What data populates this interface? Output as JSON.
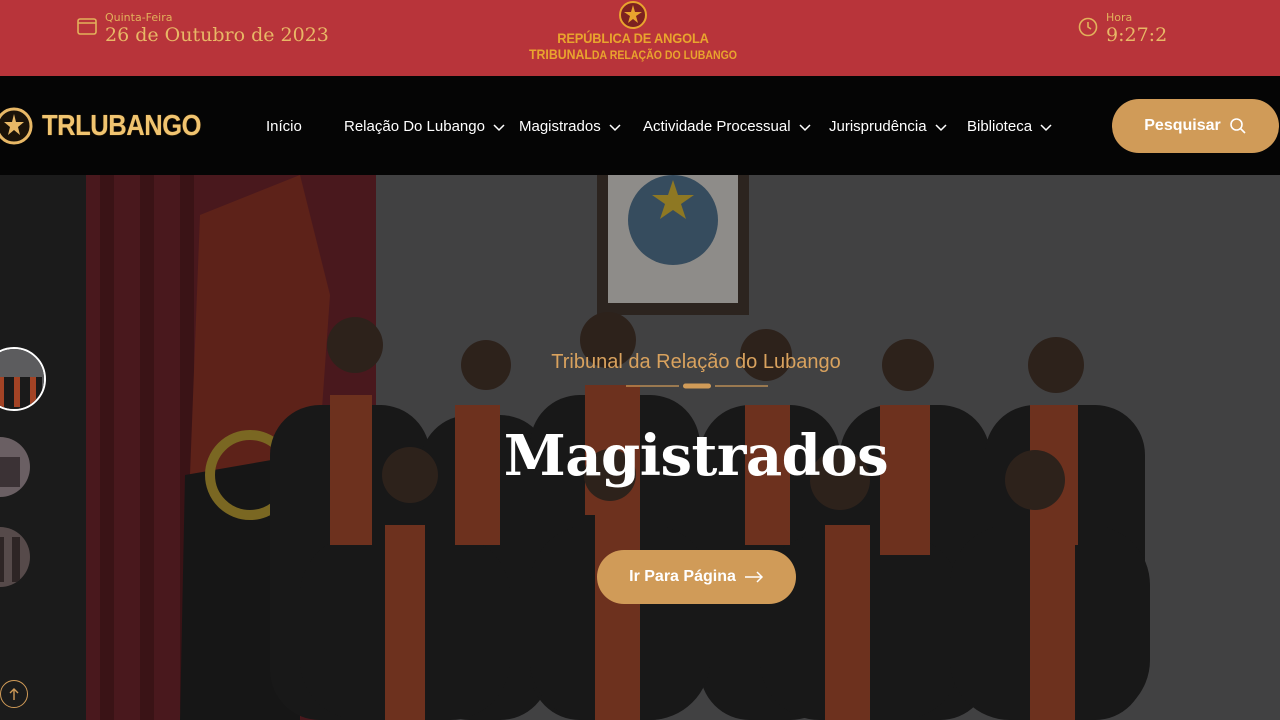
{
  "topbar": {
    "day_label": "Quinta-Feira",
    "date": "26 de Outubro de 2023",
    "time_label": "Hora",
    "time": "9:27:2",
    "emblem_line1": "REPÚBLICA DE ANGOLA",
    "emblem_line2_main": "TRIBUNAL",
    "emblem_line2_small": "DA RELAÇÃO DO LUBANGO",
    "calendar_icon": "calendar-icon",
    "clock_icon": "clock-icon"
  },
  "navbar": {
    "logo_text": "TRLUBANGO",
    "items": [
      {
        "label": "Início",
        "has_dropdown": false
      },
      {
        "label": "Relação Do Lubango",
        "has_dropdown": true
      },
      {
        "label": "Magistrados",
        "has_dropdown": true
      },
      {
        "label": "Actividade Processual",
        "has_dropdown": true
      },
      {
        "label": "Jurisprudência",
        "has_dropdown": true
      },
      {
        "label": "Biblioteca",
        "has_dropdown": true
      }
    ],
    "search_label": "Pesquisar",
    "search_icon": "search-icon"
  },
  "hero": {
    "subtitle": "Tribunal da Relação do Lubango",
    "title": "Magistrados",
    "cta_label": "Ir Para Página",
    "cta_icon": "arrow-right-icon"
  },
  "colors": {
    "topbar_bg": "#b8343a",
    "accent_gold": "#d09b58",
    "navbar_bg": "#050505"
  }
}
